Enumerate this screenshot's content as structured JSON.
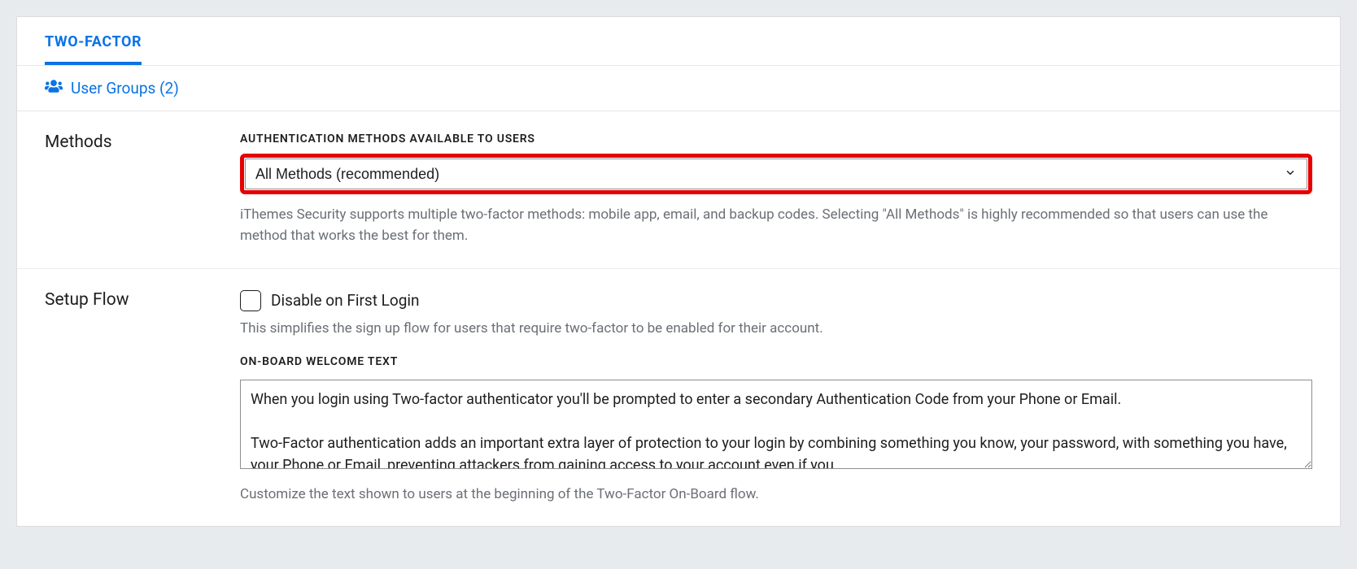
{
  "tabs": {
    "active_label": "TWO-FACTOR"
  },
  "subnav": {
    "user_groups_label": "User Groups (2)"
  },
  "methods": {
    "section_title": "Methods",
    "field_label": "AUTHENTICATION METHODS AVAILABLE TO USERS",
    "selected_value": "All Methods (recommended)",
    "helper": "iThemes Security supports multiple two-factor methods: mobile app, email, and backup codes. Selecting \"All Methods\" is highly recommended so that users can use the method that works the best for them."
  },
  "setup_flow": {
    "section_title": "Setup Flow",
    "disable_first_login_label": "Disable on First Login",
    "disable_first_login_helper": "This simplifies the sign up flow for users that require two-factor to be enabled for their account.",
    "welcome_label": "ON-BOARD WELCOME TEXT",
    "welcome_value": "When you login using Two-factor authenticator you'll be prompted to enter a secondary Authentication Code from your Phone or Email.\n\nTwo-Factor authentication adds an important extra layer of protection to your login by combining something you know, your password, with something you have, your Phone or Email, preventing attackers from gaining access to your account even if you",
    "welcome_helper": "Customize the text shown to users at the beginning of the Two-Factor On-Board flow."
  }
}
